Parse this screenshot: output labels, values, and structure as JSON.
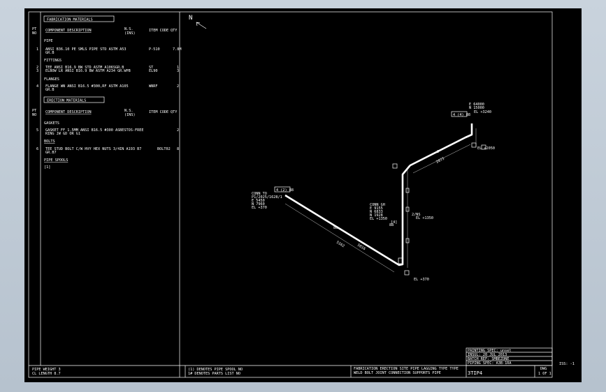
{
  "north_label": "N",
  "left_panel": {
    "col_pt_no": "PT\nNO",
    "fabrication": {
      "title": "FABRICATION MATERIALS",
      "header_desc": "COMPONENT DESCRIPTION",
      "header_ns": "N.S.\n(INS)",
      "header_code": "ITEM CODE",
      "header_qty": "QTY",
      "groups": [
        {
          "name": "PIPE",
          "rows": [
            {
              "pt": "1",
              "desc": "ANSI B36.10 PE SMLS PIPE STD ASTM A53\nGR.B",
              "ns": "",
              "code": "P-510",
              "qty": "7.8M"
            }
          ]
        },
        {
          "name": "FITTINGS",
          "rows": [
            {
              "pt": "2",
              "desc": "TEE ANSI B16.9 BW STD ASTM A106SGR.B",
              "ns": "",
              "code": "ST",
              "qty": "1"
            },
            {
              "pt": "3",
              "desc": "ELBOW LR ANSI B16.9 BW ASTM A234 GR.WPB",
              "ns": "",
              "code": "EL90",
              "qty": "3"
            }
          ]
        },
        {
          "name": "FLANGES",
          "rows": [
            {
              "pt": "4",
              "desc": "FLANGE WN ANSI B16.5 #300,RF ASTM A105\nGR.B",
              "ns": "",
              "code": "WNRF",
              "qty": "2"
            }
          ]
        }
      ]
    },
    "erection": {
      "title": "ERECTION MATERIALS",
      "header_desc": "COMPONENT DESCRIPTION",
      "header_ns": "N.S.\n(INS)",
      "header_code": "ITEM CODE",
      "header_qty": "QTY",
      "groups": [
        {
          "name": "GASKETS",
          "rows": [
            {
              "pt": "5",
              "desc": "GASKET FF 1.5MM ANSI B16.5 #300 ASBESTOS-FREE\nRING JW GD OR G1",
              "ns": "",
              "code": "GFF",
              "qty": "2"
            }
          ]
        },
        {
          "name": "BOLTS",
          "rows": [
            {
              "pt": "6",
              "desc": "TEE STUD BOLT C/W HVY HEX NUTS 3/4IN A193 B7\nGR.B7",
              "ns": "",
              "code": "BOLT02",
              "qty": "8"
            }
          ]
        },
        {
          "name": "PIPE SPOOLS",
          "rows": [
            {
              "pt": "",
              "desc": "[1]",
              "ns": "",
              "code": "",
              "qty": ""
            }
          ]
        }
      ]
    }
  },
  "footer": {
    "pipe_weight": "PIPE WEIGHT  3",
    "cl_length": "CL LENGTH  8.7",
    "legend_1": "(1) DENOTES PIPE SPOOL NO",
    "legend_2": "1# DENOTES PARTS LIST NO",
    "cols": [
      "FABRICATION",
      "ERECTION",
      "SITE",
      "PIPE",
      "LAGGING",
      "TYPE",
      "TYPE"
    ],
    "cols_2": [
      "WELD",
      "BOLT",
      "JOINT",
      "CONNECTION",
      "SUPPORTS",
      "PIPE"
    ],
    "drawing_no": "3TIP4",
    "dwg_label": "DWG",
    "sheet": "1 OF 1",
    "iss": "ISS: -1"
  },
  "title_block": {
    "painting": "PAINTING SPEC: unset",
    "insul": "INSUL: 20 JUL 2013",
    "batch": "BATCH REF: SMBEZONE",
    "piping_spec": "PIPING SPEC: A3B-1RA"
  },
  "iso": {
    "conn_left": [
      "CONN TO",
      "P1/2025/1628/1",
      "E 5450",
      "N 7960",
      "EL +370"
    ],
    "tag_left": "4 (2) 88",
    "conn_mid": [
      "CONN GH",
      "E 9155",
      "N 6833",
      "N 1928",
      "EL +1350"
    ],
    "tag_top": "4 (4) 88",
    "coord_top": [
      "E 64000",
      "N 15000",
      "EL +3240"
    ],
    "label_el_top": "EL +3240",
    "label_el_right": "EL +2050",
    "label_el_bottom": "EL +370",
    "label_el_mid": "EL +1350",
    "label_ns": "2/NS",
    "label_flange": "[4]",
    "dim_a": "5162",
    "dim_b": "2073",
    "dim_c": "5016",
    "dim_d": "88",
    "dim_e": "2",
    "dim_f": "88"
  }
}
